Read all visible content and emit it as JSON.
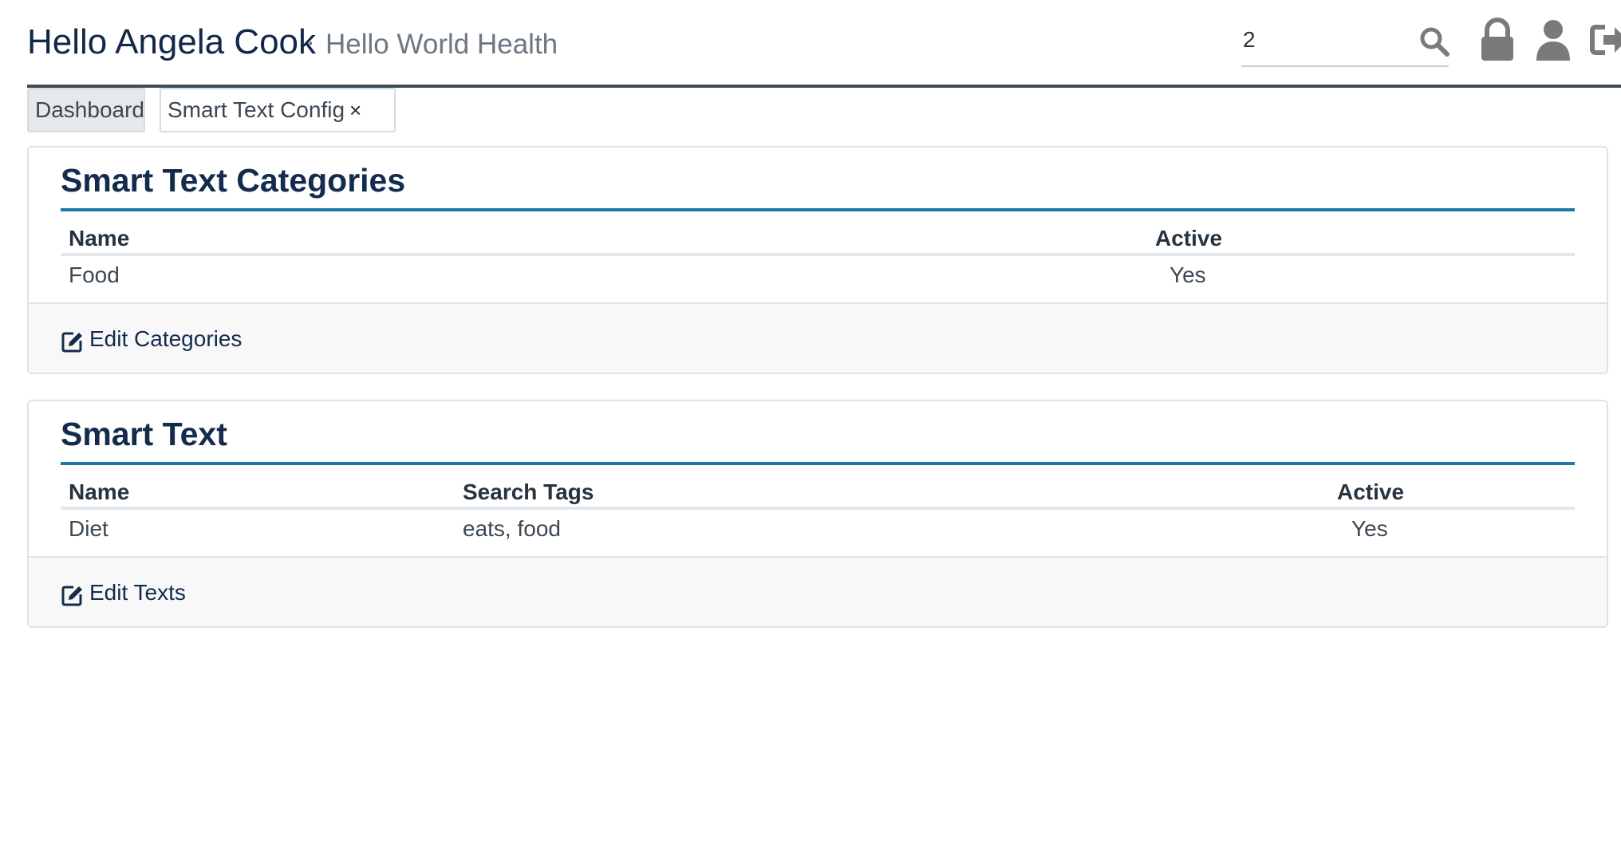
{
  "header": {
    "greeting": "Hello Angela Cook",
    "separator": "·",
    "org_name": "Hello World Health",
    "search": {
      "value": "2",
      "placeholder": ""
    },
    "icons": [
      "search-icon",
      "lock-icon",
      "user-icon",
      "logout-icon"
    ]
  },
  "tabs": {
    "dashboard": "Dashboard",
    "smart_text_config": "Smart Text Config",
    "close_glyph": "×"
  },
  "categories_panel": {
    "title": "Smart Text Categories",
    "columns": {
      "name": "Name",
      "active": "Active"
    },
    "rows": [
      {
        "name": "Food",
        "active": "Yes"
      }
    ],
    "edit_label": "Edit Categories"
  },
  "texts_panel": {
    "title": "Smart Text",
    "columns": {
      "name": "Name",
      "search_tags": "Search Tags",
      "active": "Active"
    },
    "rows": [
      {
        "name": "Diet",
        "search_tags": "eats, food",
        "active": "Yes"
      }
    ],
    "edit_label": "Edit Texts"
  },
  "colors": {
    "heading": "#132b4d",
    "accent_rule": "#1a7aa5",
    "header_rule": "#3e4d55",
    "icon_gray": "#7a7a7a"
  }
}
